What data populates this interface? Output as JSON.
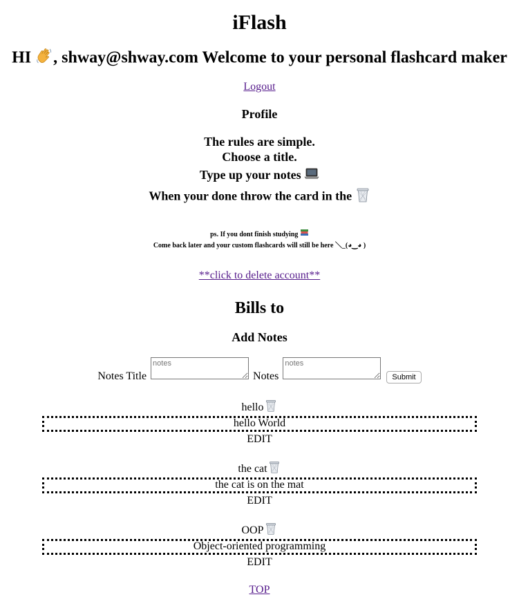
{
  "header": {
    "app_title": "iFlash",
    "greeting_prefix": "HI ",
    "greeting_email": ", shway@shway.com Welcome to your personal flashcard maker",
    "wave_icon": "waving-hand-icon"
  },
  "nav": {
    "logout_label": "Logout",
    "top_label": "TOP"
  },
  "profile": {
    "heading": "Profile",
    "rules": [
      "The rules are simple.",
      "Choose a title.",
      "Type up your notes",
      "When your done throw the card in the"
    ],
    "ps_line1": "ps. If you dont finish studying",
    "ps_line2": "Come back later and your custom flashcards will still be here ＼_(◕‿◕ )",
    "delete_account_label": "**click to delete account**"
  },
  "deck": {
    "title": "Bills to",
    "add_notes_heading": "Add Notes",
    "form": {
      "title_label": "Notes Title",
      "title_placeholder": "notes",
      "notes_label": "Notes",
      "notes_placeholder": "notes",
      "submit_label": "Submit"
    },
    "cards": [
      {
        "title": "hello",
        "body": "hello World",
        "edit_label": "EDIT"
      },
      {
        "title": "the cat",
        "body": "the cat is on the mat",
        "edit_label": "EDIT"
      },
      {
        "title": "OOP",
        "body": "Object-oriented programming",
        "edit_label": "EDIT"
      }
    ]
  },
  "icons": {
    "wave": "waving-hand-icon",
    "laptop": "laptop-icon",
    "trash": "trash-can-icon",
    "books": "books-icon"
  },
  "colors": {
    "link": "#551a8b",
    "text": "#000000",
    "background": "#ffffff"
  }
}
